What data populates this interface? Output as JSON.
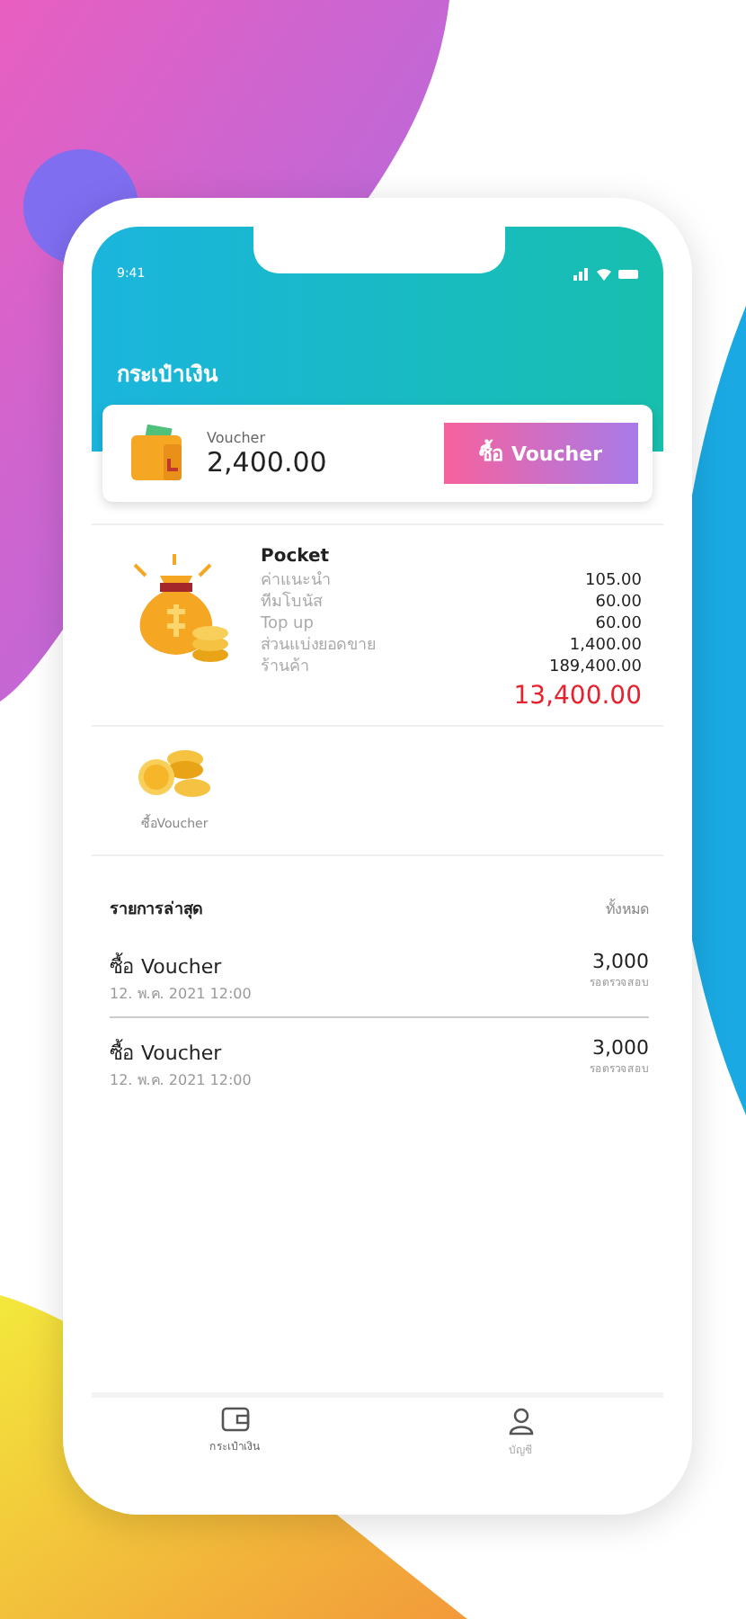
{
  "status_bar": {
    "time": "9:41"
  },
  "header": {
    "title": "กระเป๋าเงิน"
  },
  "voucher_card": {
    "label": "Voucher",
    "amount": "2,400.00",
    "button": "ซื้อ Voucher"
  },
  "pocket": {
    "title": "Pocket",
    "rows": [
      {
        "label": "ค่าแนะนำ",
        "value": "105.00"
      },
      {
        "label": "ทีมโบนัส",
        "value": "60.00"
      },
      {
        "label": "Top up",
        "value": "60.00"
      },
      {
        "label": "ส่วนแบ่งยอดขาย",
        "value": "1,400.00"
      },
      {
        "label": "ร้านค้า",
        "value": "189,400.00"
      }
    ],
    "total": "13,400.00"
  },
  "shortcut": {
    "label": "ซื้อVoucher"
  },
  "recent": {
    "title": "รายการล่าสุด",
    "see_all": "ทั้งหมด",
    "items": [
      {
        "title": "ซื้อ Voucher",
        "date": "12. พ.ค. 2021 12:00",
        "amount": "3,000",
        "status": "รอตรวจสอบ"
      },
      {
        "title": "ซื้อ Voucher",
        "date": "12. พ.ค. 2021 12:00",
        "amount": "3,000",
        "status": "รอตรวจสอบ"
      }
    ]
  },
  "tab_bar": [
    {
      "label": "กระเป๋าเงิน",
      "kind": "wallet",
      "selected": true
    },
    {
      "label": "บัญชี",
      "kind": "account",
      "selected": false
    }
  ]
}
